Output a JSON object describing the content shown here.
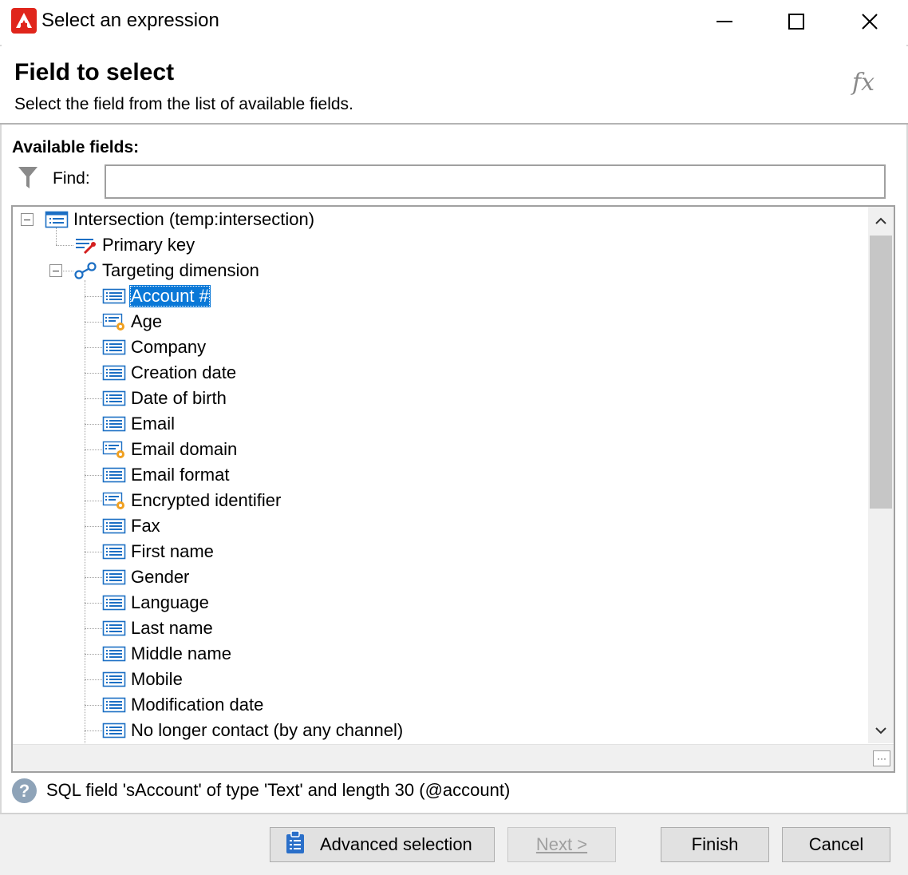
{
  "window": {
    "title": "Select an expression",
    "controls": [
      "minimize",
      "maximize",
      "close"
    ]
  },
  "header": {
    "title": "Field to select",
    "subtitle": "Select the field from the list of available fields.",
    "icon": "fx-icon"
  },
  "fields": {
    "label": "Available fields:",
    "find_label": "Find:",
    "find_value": ""
  },
  "tree": {
    "root": {
      "label": "Intersection (temp:intersection)",
      "icon": "table-icon",
      "expanded": true
    },
    "primary_key": {
      "label": "Primary key",
      "icon": "key-icon"
    },
    "link": {
      "label": "Targeting dimension",
      "icon": "link-icon",
      "expanded": true
    },
    "items": [
      {
        "label": "Account #",
        "icon": "field-icon",
        "selected": true
      },
      {
        "label": "Age",
        "icon": "computed-field-icon"
      },
      {
        "label": "Company",
        "icon": "field-icon"
      },
      {
        "label": "Creation date",
        "icon": "field-icon"
      },
      {
        "label": "Date of birth",
        "icon": "field-icon"
      },
      {
        "label": "Email",
        "icon": "field-icon"
      },
      {
        "label": "Email domain",
        "icon": "computed-field-icon"
      },
      {
        "label": "Email format",
        "icon": "field-icon"
      },
      {
        "label": "Encrypted identifier",
        "icon": "computed-field-icon"
      },
      {
        "label": "Fax",
        "icon": "field-icon"
      },
      {
        "label": "First name",
        "icon": "field-icon"
      },
      {
        "label": "Gender",
        "icon": "field-icon"
      },
      {
        "label": "Language",
        "icon": "field-icon"
      },
      {
        "label": "Last name",
        "icon": "field-icon"
      },
      {
        "label": "Middle name",
        "icon": "field-icon"
      },
      {
        "label": "Mobile",
        "icon": "field-icon"
      },
      {
        "label": "Modification date",
        "icon": "field-icon"
      },
      {
        "label": "No longer contact (by any channel)",
        "icon": "field-icon"
      }
    ]
  },
  "info": {
    "text": "SQL field 'sAccount' of type 'Text' and length 30 (@account)"
  },
  "buttons": {
    "advanced": "Advanced selection",
    "next": "Next >",
    "finish": "Finish",
    "cancel": "Cancel"
  },
  "colors": {
    "selection": "#0a78d7",
    "brand": "#e0251b",
    "icon_blue": "#1c6fc4",
    "computed_orange": "#f0a020"
  }
}
